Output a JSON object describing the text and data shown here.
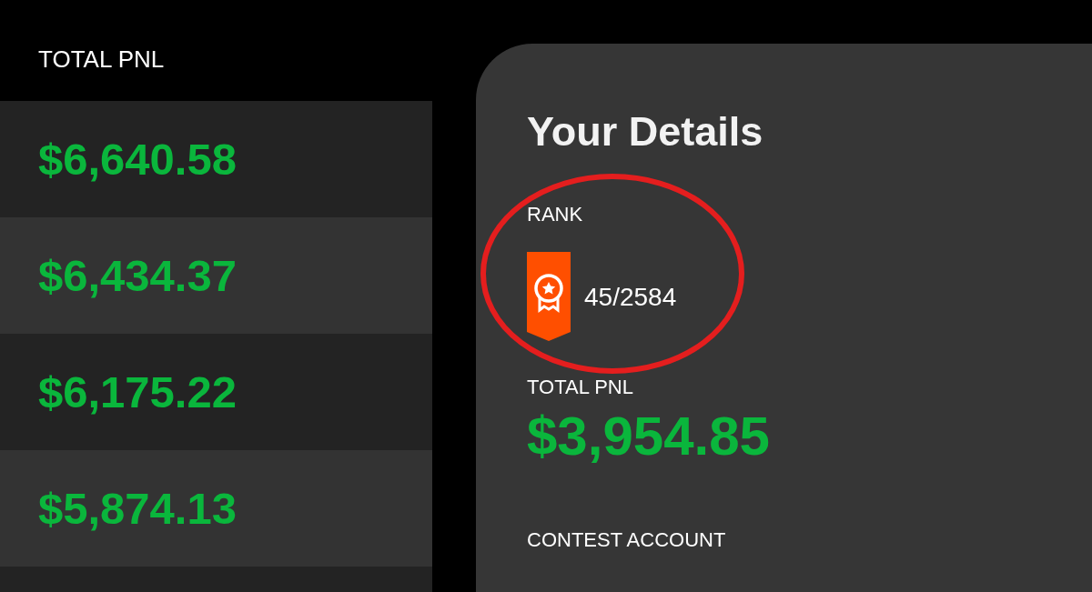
{
  "leaderboard": {
    "column_title": "TOTAL PNL",
    "rows": [
      {
        "pnl": "$6,640.58"
      },
      {
        "pnl": "$6,434.37"
      },
      {
        "pnl": "$6,175.22"
      },
      {
        "pnl": "$5,874.13"
      }
    ]
  },
  "details": {
    "title": "Your Details",
    "rank": {
      "label": "RANK",
      "value": "45/2584",
      "circled": true
    },
    "total_pnl": {
      "label": "TOTAL PNL",
      "value": "$3,954.85"
    },
    "contest_account": {
      "label": "CONTEST ACCOUNT"
    }
  }
}
